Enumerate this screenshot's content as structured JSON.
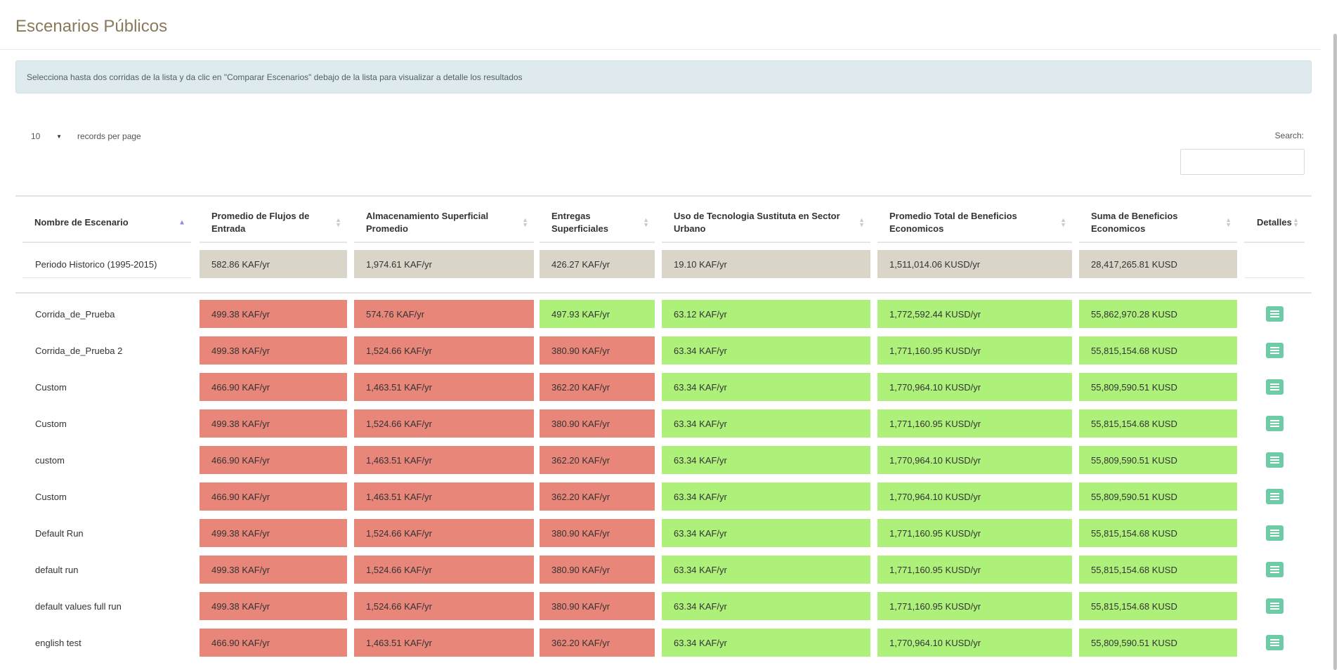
{
  "page": {
    "title": "Escenarios Públicos",
    "info": "Selecciona hasta dos corridas de la lista y da clic en \"Comparar Escenarios\" debajo de la lista para visualizar a detalle los resultados"
  },
  "controls": {
    "page_length": "10",
    "records_label": "records per page",
    "search_label": "Search:",
    "search_value": ""
  },
  "colors": {
    "historic": "#d9d5c8",
    "worse": "#e8867a",
    "better": "#adf17b",
    "detail_button": "#6dcba6"
  },
  "table": {
    "columns": [
      "Nombre de Escenario",
      "Promedio de Flujos de Entrada",
      "Almacenamiento Superficial Promedio",
      "Entregas Superficiales",
      "Uso de Tecnologia Sustituta en Sector Urbano",
      "Promedio Total de Beneficios Economicos",
      "Suma de Beneficios Economicos",
      "Detalles"
    ],
    "historic": {
      "name": "Periodo Historico (1995-2015)",
      "values": [
        "582.86 KAF/yr",
        "1,974.61 KAF/yr",
        "426.27 KAF/yr",
        "19.10 KAF/yr",
        "1,511,014.06 KUSD/yr",
        "28,417,265.81 KUSD"
      ]
    },
    "rows": [
      {
        "name": "Corrida_de_Prueba",
        "values": [
          "499.38 KAF/yr",
          "574.76 KAF/yr",
          "497.93 KAF/yr",
          "63.12 KAF/yr",
          "1,772,592.44 KUSD/yr",
          "55,862,970.28 KUSD"
        ],
        "status": [
          "worse",
          "worse",
          "better",
          "better",
          "better",
          "better"
        ]
      },
      {
        "name": "Corrida_de_Prueba 2",
        "values": [
          "499.38 KAF/yr",
          "1,524.66 KAF/yr",
          "380.90 KAF/yr",
          "63.34 KAF/yr",
          "1,771,160.95 KUSD/yr",
          "55,815,154.68 KUSD"
        ],
        "status": [
          "worse",
          "worse",
          "worse",
          "better",
          "better",
          "better"
        ]
      },
      {
        "name": "Custom",
        "values": [
          "466.90 KAF/yr",
          "1,463.51 KAF/yr",
          "362.20 KAF/yr",
          "63.34 KAF/yr",
          "1,770,964.10 KUSD/yr",
          "55,809,590.51 KUSD"
        ],
        "status": [
          "worse",
          "worse",
          "worse",
          "better",
          "better",
          "better"
        ]
      },
      {
        "name": "Custom",
        "values": [
          "499.38 KAF/yr",
          "1,524.66 KAF/yr",
          "380.90 KAF/yr",
          "63.34 KAF/yr",
          "1,771,160.95 KUSD/yr",
          "55,815,154.68 KUSD"
        ],
        "status": [
          "worse",
          "worse",
          "worse",
          "better",
          "better",
          "better"
        ]
      },
      {
        "name": "custom",
        "values": [
          "466.90 KAF/yr",
          "1,463.51 KAF/yr",
          "362.20 KAF/yr",
          "63.34 KAF/yr",
          "1,770,964.10 KUSD/yr",
          "55,809,590.51 KUSD"
        ],
        "status": [
          "worse",
          "worse",
          "worse",
          "better",
          "better",
          "better"
        ]
      },
      {
        "name": "Custom",
        "values": [
          "466.90 KAF/yr",
          "1,463.51 KAF/yr",
          "362.20 KAF/yr",
          "63.34 KAF/yr",
          "1,770,964.10 KUSD/yr",
          "55,809,590.51 KUSD"
        ],
        "status": [
          "worse",
          "worse",
          "worse",
          "better",
          "better",
          "better"
        ]
      },
      {
        "name": "Default Run",
        "values": [
          "499.38 KAF/yr",
          "1,524.66 KAF/yr",
          "380.90 KAF/yr",
          "63.34 KAF/yr",
          "1,771,160.95 KUSD/yr",
          "55,815,154.68 KUSD"
        ],
        "status": [
          "worse",
          "worse",
          "worse",
          "better",
          "better",
          "better"
        ]
      },
      {
        "name": "default run",
        "values": [
          "499.38 KAF/yr",
          "1,524.66 KAF/yr",
          "380.90 KAF/yr",
          "63.34 KAF/yr",
          "1,771,160.95 KUSD/yr",
          "55,815,154.68 KUSD"
        ],
        "status": [
          "worse",
          "worse",
          "worse",
          "better",
          "better",
          "better"
        ]
      },
      {
        "name": "default values full run",
        "values": [
          "499.38 KAF/yr",
          "1,524.66 KAF/yr",
          "380.90 KAF/yr",
          "63.34 KAF/yr",
          "1,771,160.95 KUSD/yr",
          "55,815,154.68 KUSD"
        ],
        "status": [
          "worse",
          "worse",
          "worse",
          "better",
          "better",
          "better"
        ]
      },
      {
        "name": "english test",
        "values": [
          "466.90 KAF/yr",
          "1,463.51 KAF/yr",
          "362.20 KAF/yr",
          "63.34 KAF/yr",
          "1,770,964.10 KUSD/yr",
          "55,809,590.51 KUSD"
        ],
        "status": [
          "worse",
          "worse",
          "worse",
          "better",
          "better",
          "better"
        ]
      }
    ]
  }
}
